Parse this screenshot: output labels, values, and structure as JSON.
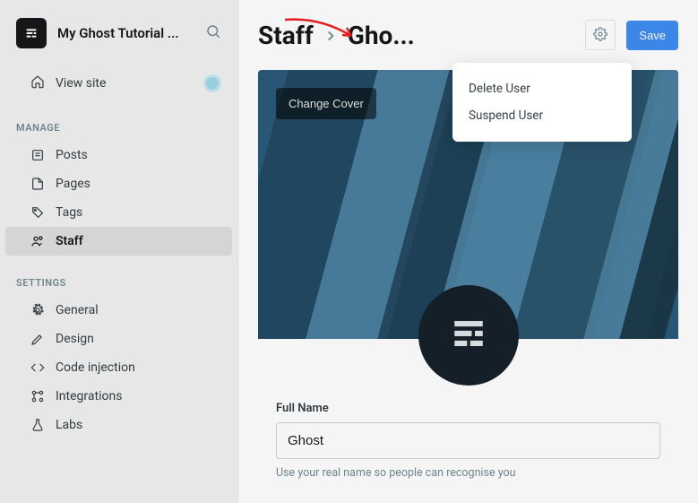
{
  "site": {
    "title": "My Ghost Tutorial ..."
  },
  "sidebar": {
    "view_site": "View site",
    "sections": {
      "manage_label": "MANAGE",
      "settings_label": "SETTINGS"
    },
    "manage_items": [
      {
        "label": "Posts"
      },
      {
        "label": "Pages"
      },
      {
        "label": "Tags"
      },
      {
        "label": "Staff"
      }
    ],
    "settings_items": [
      {
        "label": "General"
      },
      {
        "label": "Design"
      },
      {
        "label": "Code injection"
      },
      {
        "label": "Integrations"
      },
      {
        "label": "Labs"
      }
    ]
  },
  "header": {
    "breadcrumb_root": "Staff",
    "breadcrumb_current": "Gho...",
    "save_label": "Save"
  },
  "dropdown": {
    "delete_label": "Delete User",
    "suspend_label": "Suspend User"
  },
  "cover": {
    "change_label": "Change Cover"
  },
  "form": {
    "fullname_label": "Full Name",
    "fullname_value": "Ghost",
    "fullname_hint": "Use your real name so people can recognise you"
  }
}
